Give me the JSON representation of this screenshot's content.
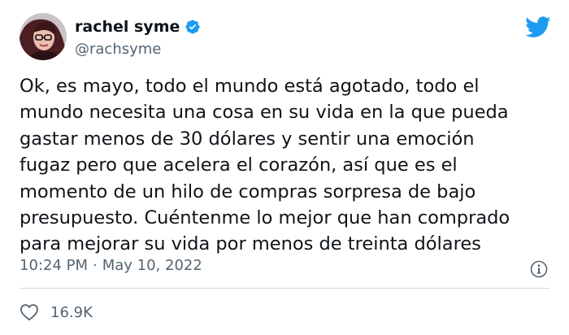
{
  "author": {
    "display_name": "rachel syme",
    "handle": "@rachsyme",
    "verified": true,
    "avatar_icon": "profile-photo",
    "brand_icon": "twitter-bird-icon"
  },
  "tweet": {
    "lines": [
      "Ok, es mayo, todo el mundo está agotado, todo el",
      "mundo necesita una cosa en su vida en la que pueda",
      "gastar menos de 30 dólares y sentir una emoción",
      "fugaz pero que acelera el corazón, así que es el",
      "momento de un hilo de compras sorpresa de bajo",
      "presupuesto. Cuéntenme lo mejor que han comprado",
      "para mejorar su vida por menos de treinta dólares"
    ],
    "time": "10:24 PM",
    "separator": "·",
    "date": "May 10, 2022"
  },
  "engagement": {
    "likes": "16.9K"
  },
  "colors": {
    "text": "#0f1419",
    "secondary": "#536471",
    "brand_blue": "#1d9bf0",
    "divider": "#cfd9de"
  }
}
